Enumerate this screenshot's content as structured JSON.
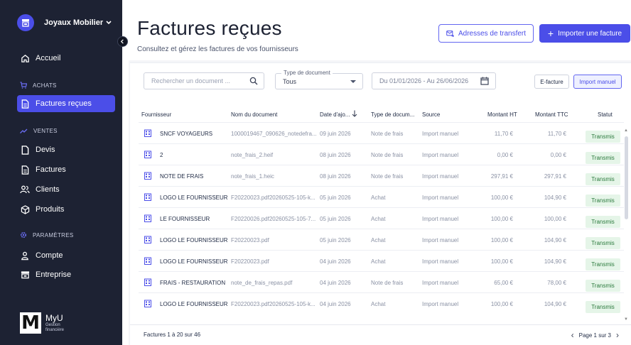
{
  "sidebar": {
    "org_name": "Joyaux Mobilier",
    "nav": {
      "accueil": "Accueil",
      "achats_title": "ACHATS",
      "factures_recues": "Factures reçues",
      "ventes_title": "VENTES",
      "devis": "Devis",
      "factures": "Factures",
      "clients": "Clients",
      "produits": "Produits",
      "parametres_title": "PARAMÈTRES",
      "compte": "Compte",
      "entreprise": "Entreprise"
    },
    "brand": {
      "name": "MyU",
      "line1": "Gestion",
      "line2": "financière"
    }
  },
  "header": {
    "title": "Factures reçues",
    "subtitle": "Consultez et gérez les factures de vos fournisseurs",
    "transfer_button": "Adresses de transfert",
    "import_button": "Importer une facture"
  },
  "filters": {
    "search_placeholder": "Rechercher un document ...",
    "type_label": "Type de document",
    "type_value": "Tous",
    "date_range": "Du 01/01/2026 - Au 26/06/2026",
    "efacture": "E-facture",
    "import_manuel": "Import manuel"
  },
  "table": {
    "headers": {
      "fournisseur": "Fournisseur",
      "document": "Nom du document",
      "date": "Date d'ajo...",
      "type": "Type de docum...",
      "source": "Source",
      "ht": "Montant HT",
      "ttc": "Montant TTC",
      "statut": "Statut"
    },
    "rows": [
      {
        "fournisseur": "SNCF VOYAGEURS",
        "document": "1000019467_090626_notedefra...",
        "date": "09 juin 2026",
        "type": "Note de frais",
        "source": "Import manuel",
        "ht": "11,70 €",
        "ttc": "11,70 €",
        "statut": "Transmis"
      },
      {
        "fournisseur": "2",
        "document": "note_frais_2.heif",
        "date": "08 juin 2026",
        "type": "Note de frais",
        "source": "Import manuel",
        "ht": "0,00 €",
        "ttc": "0,00 €",
        "statut": "Transmis"
      },
      {
        "fournisseur": "NOTE DE FRAIS",
        "document": "note_frais_1.heic",
        "date": "08 juin 2026",
        "type": "Note de frais",
        "source": "Import manuel",
        "ht": "297,91 €",
        "ttc": "297,91 €",
        "statut": "Transmis"
      },
      {
        "fournisseur": "LOGO LE FOURNISSEUR",
        "document": "F20220023.pdf20260525-105-k...",
        "date": "05 juin 2026",
        "type": "Achat",
        "source": "Import manuel",
        "ht": "100,00 €",
        "ttc": "104,90 €",
        "statut": "Transmis"
      },
      {
        "fournisseur": "LE FOURNISSEUR",
        "document": "F20220026.pdf20260525-105-7...",
        "date": "05 juin 2026",
        "type": "Achat",
        "source": "Import manuel",
        "ht": "100,00 €",
        "ttc": "100,00 €",
        "statut": "Transmis"
      },
      {
        "fournisseur": "LOGO LE FOURNISSEUR",
        "document": "F20220023.pdf",
        "date": "05 juin 2026",
        "type": "Achat",
        "source": "Import manuel",
        "ht": "100,00 €",
        "ttc": "104,90 €",
        "statut": "Transmis"
      },
      {
        "fournisseur": "LOGO LE FOURNISSEUR",
        "document": "F20220023.pdf",
        "date": "04 juin 2026",
        "type": "Achat",
        "source": "Import manuel",
        "ht": "100,00 €",
        "ttc": "104,90 €",
        "statut": "Transmis"
      },
      {
        "fournisseur": "FRAIS - RESTAURATION",
        "document": "note_de_frais_repas.pdf",
        "date": "04 juin 2026",
        "type": "Note de frais",
        "source": "Import manuel",
        "ht": "65,00 €",
        "ttc": "78,00 €",
        "statut": "Transmis"
      },
      {
        "fournisseur": "LOGO LE FOURNISSEUR",
        "document": "F20220023.pdf20260525-105-k...",
        "date": "04 juin 2026",
        "type": "Achat",
        "source": "Import manuel",
        "ht": "100,00 €",
        "ttc": "104,90 €",
        "statut": "Transmis"
      }
    ]
  },
  "footer": {
    "count": "Factures 1 à 20 sur 46",
    "page": "Page 1 sur 3"
  },
  "colors": {
    "sidebar_bg": "#1d2233",
    "accent": "#4b4ee8",
    "status_bg": "#e5f5e8",
    "status_text": "#2b7a3d"
  }
}
